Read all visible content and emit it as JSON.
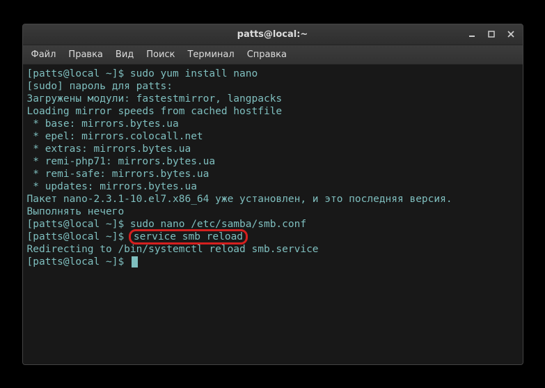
{
  "window": {
    "title": "patts@local:~"
  },
  "menu": {
    "file": "Файл",
    "edit": "Правка",
    "view": "Вид",
    "search": "Поиск",
    "terminal": "Терминал",
    "help": "Справка"
  },
  "terminal": {
    "lines": [
      "[patts@local ~]$ sudo yum install nano",
      "[sudo] пароль для patts:",
      "Загружены модули: fastestmirror, langpacks",
      "Loading mirror speeds from cached hostfile",
      " * base: mirrors.bytes.ua",
      " * epel: mirrors.colocall.net",
      " * extras: mirrors.bytes.ua",
      " * remi-php71: mirrors.bytes.ua",
      " * remi-safe: mirrors.bytes.ua",
      " * updates: mirrors.bytes.ua",
      "Пакет nano-2.3.1-10.el7.x86_64 уже установлен, и это последняя версия.",
      "Выполнять нечего",
      "[patts@local ~]$ sudo nano /etc/samba/smb.conf"
    ],
    "highlighted_prompt": "[patts@local ~]$ ",
    "highlighted_command": "service smb reload",
    "after_highlight": "Redirecting to /bin/systemctl reload smb.service",
    "final_prompt": "[patts@local ~]$ "
  }
}
